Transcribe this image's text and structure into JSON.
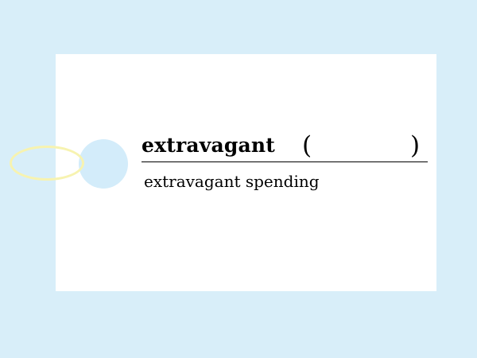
{
  "card": {
    "headword": "extravagant",
    "open_paren": "(",
    "close_paren": ")",
    "example": "extravagant spending"
  },
  "colors": {
    "background": "#d8eef9",
    "card": "#ffffff",
    "hole": "#d3ecfa",
    "string": "#f7f3b0",
    "text": "#000000"
  }
}
